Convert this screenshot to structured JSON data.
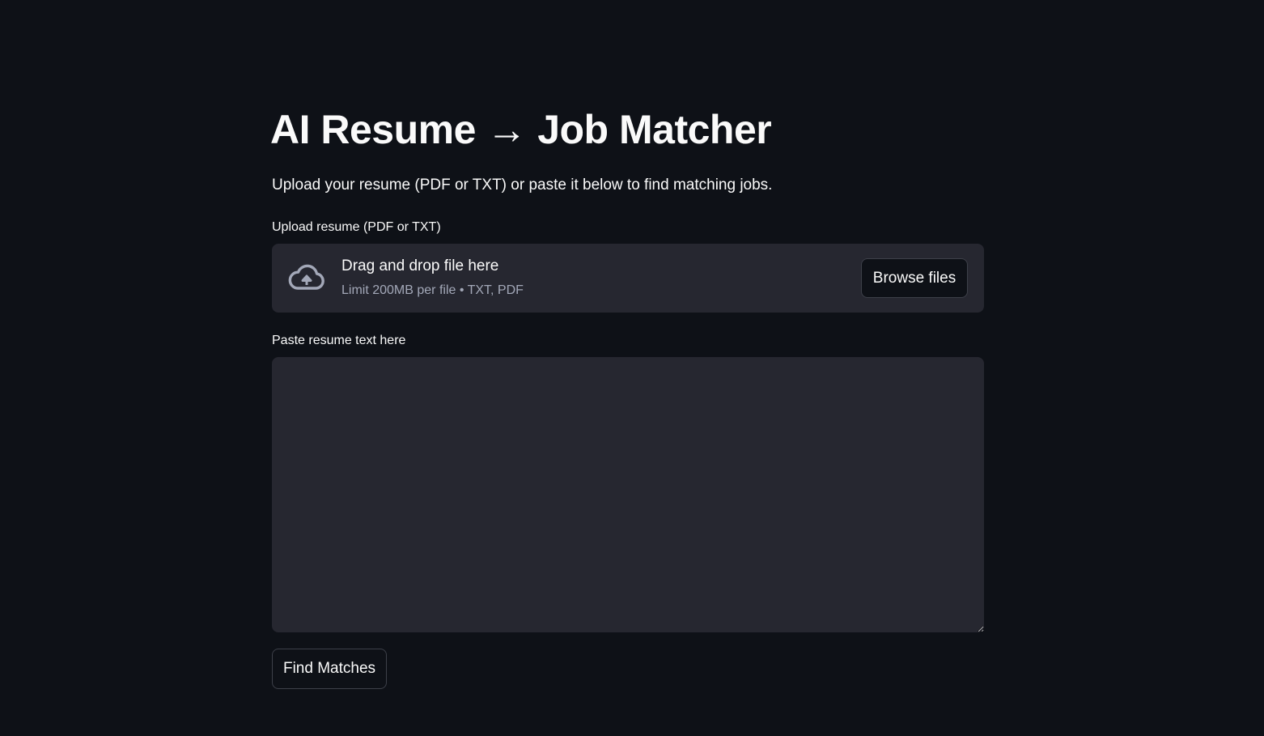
{
  "page": {
    "title": "AI Resume → Job Matcher",
    "subtitle": "Upload your resume (PDF or TXT) or paste it below to find matching jobs."
  },
  "uploader": {
    "label": "Upload resume (PDF or TXT)",
    "drop_text": "Drag and drop file here",
    "limit_text": "Limit 200MB per file • TXT, PDF",
    "browse_label": "Browse files",
    "icon": "cloud-upload-icon"
  },
  "resume_text": {
    "label": "Paste resume text here",
    "value": ""
  },
  "actions": {
    "find_label": "Find Matches"
  },
  "colors": {
    "background": "#0e1117",
    "surface": "#262730",
    "text": "#fafafa",
    "muted_text": "#a3a8b8",
    "border": "#3d4049"
  }
}
